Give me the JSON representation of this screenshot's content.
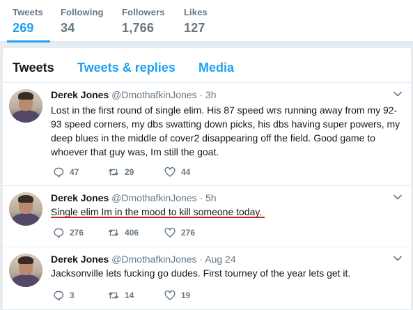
{
  "stats": {
    "tweets_label": "Tweets",
    "tweets_value": "269",
    "following_label": "Following",
    "following_value": "34",
    "followers_label": "Followers",
    "followers_value": "1,766",
    "likes_label": "Likes",
    "likes_value": "127"
  },
  "tabs": {
    "tweets": "Tweets",
    "tweets_replies": "Tweets & replies",
    "media": "Media"
  },
  "colors": {
    "accent": "#1da1f2",
    "muted_text": "#657786",
    "annotation_underline": "#c62323"
  },
  "icons": [
    "reply-icon",
    "retweet-icon",
    "like-icon",
    "chevron-down-icon"
  ],
  "tweets": [
    {
      "name": "Derek Jones",
      "handle": "@DmothafkinJones",
      "dot": "·",
      "time": "3h",
      "text": "Lost in the first round of single elim. His 87 speed wrs running away from my 92-93 speed corners, my dbs swatting down picks, his dbs having super powers, my deep blues in the middle of cover2 disappearing off the field.  Good game to whoever that guy was, Im still the goat.",
      "replies": "47",
      "retweets": "29",
      "likes": "44"
    },
    {
      "name": "Derek Jones",
      "handle": "@DmothafkinJones",
      "dot": "·",
      "time": "5h",
      "text": "Single elim  Im in the mood to kill someone today.",
      "replies": "276",
      "retweets": "406",
      "likes": "276"
    },
    {
      "name": "Derek Jones",
      "handle": "@DmothafkinJones",
      "dot": "·",
      "time": "Aug 24",
      "text": "Jacksonville lets fucking go dudes.  First tourney of the year lets get it.",
      "replies": "3",
      "retweets": "14",
      "likes": "19"
    }
  ]
}
